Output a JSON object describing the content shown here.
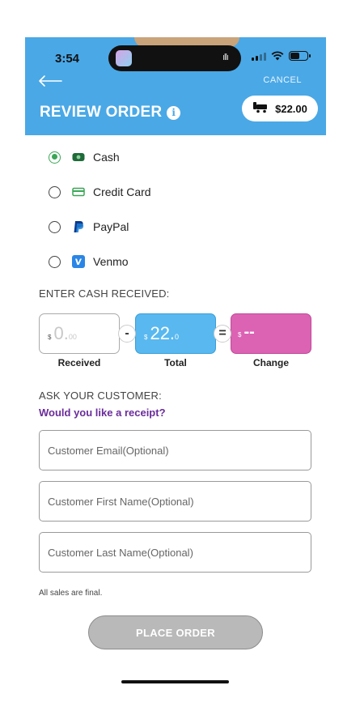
{
  "status_bar": {
    "time": "3:54"
  },
  "header": {
    "cancel_label": "CANCEL",
    "title": "REVIEW ORDER",
    "cart_total": "$22.00"
  },
  "payment_methods": [
    {
      "label": "Cash",
      "selected": true,
      "icon": "cash-icon"
    },
    {
      "label": "Credit Card",
      "selected": false,
      "icon": "credit-card-icon"
    },
    {
      "label": "PayPal",
      "selected": false,
      "icon": "paypal-icon"
    },
    {
      "label": "Venmo",
      "selected": false,
      "icon": "venmo-icon"
    }
  ],
  "cash_section": {
    "label": "ENTER CASH RECEIVED:",
    "received": {
      "currency": "$",
      "whole": "0.",
      "cents": "00",
      "caption": "Received"
    },
    "minus_sign": "-",
    "total": {
      "currency": "$",
      "whole": "22.",
      "cents": "0",
      "caption": "Total"
    },
    "equals_sign": "=",
    "change": {
      "currency": "$",
      "value": "--",
      "caption": "Change"
    }
  },
  "customer_section": {
    "label": "ASK YOUR CUSTOMER:",
    "question": "Would you like a receipt?",
    "email_placeholder": "Customer Email(Optional)",
    "first_name_placeholder": "Customer First Name(Optional)",
    "last_name_placeholder": "Customer Last Name(Optional)"
  },
  "disclaimer": "All sales are final.",
  "place_order_label": "PLACE ORDER",
  "colors": {
    "header_blue": "#4aa8e6",
    "total_blue": "#58b8ef",
    "change_pink": "#dc62b4",
    "selected_green": "#3aa655",
    "receipt_purple": "#6a2c9b",
    "button_disabled_gray": "#b9b9b9"
  }
}
